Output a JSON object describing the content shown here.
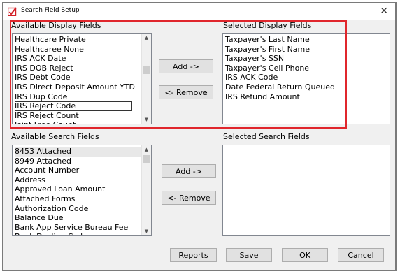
{
  "window": {
    "title": "Search Field Setup",
    "close_glyph": "X"
  },
  "display": {
    "available_label": "Available Display Fields",
    "selected_label": "Selected Display Fields",
    "available_items": [
      "Healthcare Private",
      "Healthcaree None",
      "IRS ACK Date",
      "IRS DOB Reject",
      "IRS Debt Code",
      "IRS Direct Deposit Amount YTD",
      "IRS Dup Code",
      "IRS Reject Code",
      "IRS Reject Count",
      "Joint Free Count"
    ],
    "selected_items": [
      "Taxpayer's Last Name",
      "Taxpayer's First Name",
      "Taxpayer's SSN",
      "Taxpayer's Cell Phone",
      "IRS ACK Code",
      "Date Federal Return Queued",
      "IRS Refund Amount"
    ],
    "add_label": "Add ->",
    "remove_label": "<- Remove"
  },
  "search": {
    "available_label": "Available Search Fields",
    "selected_label": "Selected Search Fields",
    "available_items": [
      "8453 Attached",
      "8949 Attached",
      "Account Number",
      "Address",
      "Approved Loan Amount",
      "Attached Forms",
      "Authorization Code",
      "Balance Due",
      "Bank App Service Bureau Fee",
      "Bank Decline Code"
    ],
    "selected_items": [],
    "add_label": "Add ->",
    "remove_label": "<- Remove"
  },
  "footer": {
    "reports_label": "Reports",
    "save_label": "Save",
    "ok_label": "OK",
    "cancel_label": "Cancel"
  },
  "colors": {
    "highlight_border": "#e0262c",
    "app_icon": "#d21f26"
  }
}
